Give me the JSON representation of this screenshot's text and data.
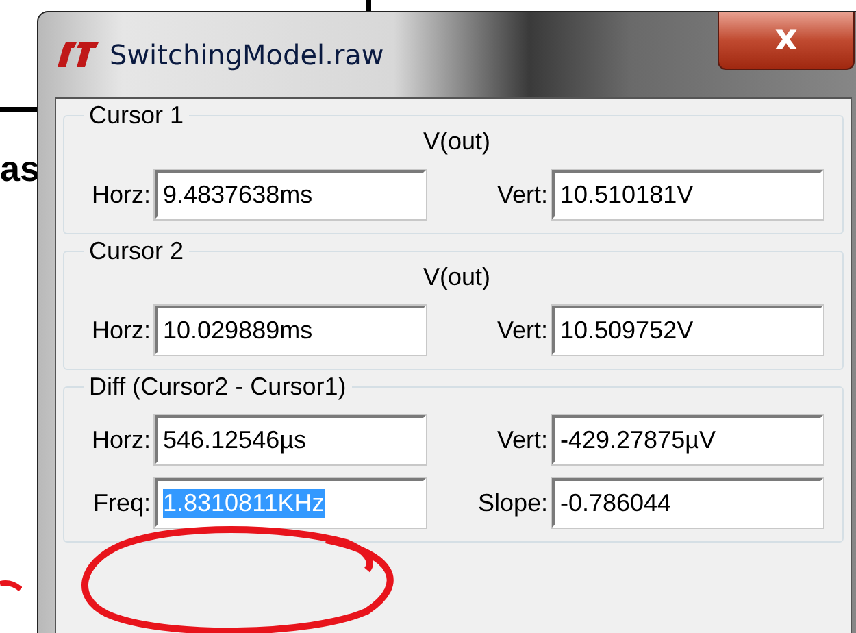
{
  "background": {
    "text": "as"
  },
  "window": {
    "title": "SwitchingModel.raw",
    "close_label": "x"
  },
  "groups": [
    {
      "title": "Cursor 1",
      "signal": "V(out)",
      "fields": [
        {
          "label": "Horz:",
          "value": "9.4837638ms",
          "selected": false
        },
        {
          "label": "Vert:",
          "value": "10.510181V",
          "selected": false
        }
      ]
    },
    {
      "title": "Cursor 2",
      "signal": "V(out)",
      "fields": [
        {
          "label": "Horz:",
          "value": "10.029889ms",
          "selected": false
        },
        {
          "label": "Vert:",
          "value": "10.509752V",
          "selected": false
        }
      ]
    },
    {
      "title": "Diff (Cursor2 - Cursor1)",
      "fields": [
        {
          "label": "Horz:",
          "value": "546.12546µs",
          "selected": false
        },
        {
          "label": "Vert:",
          "value": "-429.27875µV",
          "selected": false
        },
        {
          "label": "Freq:",
          "value": "1.8310811KHz",
          "selected": true
        },
        {
          "label": "Slope:",
          "value": "-0.786044",
          "selected": false
        }
      ]
    }
  ]
}
